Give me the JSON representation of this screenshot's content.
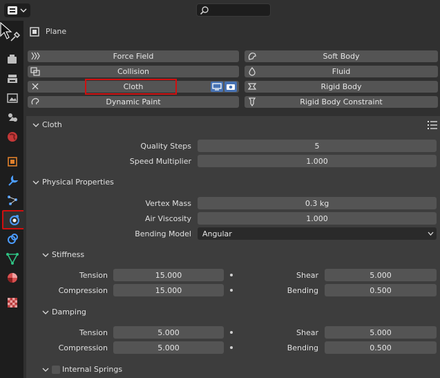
{
  "header": {
    "search_placeholder": ""
  },
  "object": {
    "name": "Plane"
  },
  "physics_buttons": [
    {
      "label": "Force Field"
    },
    {
      "label": "Soft Body"
    },
    {
      "label": "Collision"
    },
    {
      "label": "Fluid"
    },
    {
      "label": "Cloth"
    },
    {
      "label": "Rigid Body"
    },
    {
      "label": "Dynamic Paint"
    },
    {
      "label": "Rigid Body Constraint"
    }
  ],
  "cloth": {
    "title": "Cloth",
    "quality_steps_label": "Quality Steps",
    "quality_steps": "5",
    "speed_multiplier_label": "Speed Multiplier",
    "speed_multiplier": "1.000"
  },
  "physical": {
    "title": "Physical Properties",
    "vertex_mass_label": "Vertex Mass",
    "vertex_mass": "0.3 kg",
    "air_viscosity_label": "Air Viscosity",
    "air_viscosity": "1.000",
    "bending_model_label": "Bending Model",
    "bending_model": "Angular"
  },
  "stiffness": {
    "title": "Stiffness",
    "tension_label": "Tension",
    "tension": "15.000",
    "compression_label": "Compression",
    "compression": "15.000",
    "shear_label": "Shear",
    "shear": "5.000",
    "bending_label": "Bending",
    "bending": "0.500"
  },
  "damping": {
    "title": "Damping",
    "tension_label": "Tension",
    "tension": "5.000",
    "compression_label": "Compression",
    "compression": "5.000",
    "shear_label": "Shear",
    "shear": "5.000",
    "bending_label": "Bending",
    "bending": "0.500"
  },
  "internal_springs": {
    "title": "Internal Springs"
  },
  "colors": {
    "highlight": "#d10f0f",
    "active_icon": "#4b9cff"
  }
}
